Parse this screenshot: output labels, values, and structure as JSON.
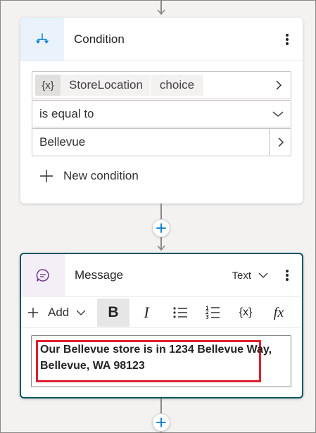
{
  "condition_card": {
    "title": "Condition",
    "variable_icon_text": "{x}",
    "variable_name": "StoreLocation",
    "variable_type": "choice",
    "operator": "is equal to",
    "value": "Bellevue",
    "new_condition_label": "New condition"
  },
  "message_card": {
    "title": "Message",
    "type_selector": "Text",
    "add_label": "Add",
    "bold_label": "B",
    "italic_label": "I",
    "variable_label": "{x}",
    "formula_label": "fx",
    "message_text": "Our Bellevue store is in 1234 Bellevue Way, Bellevue, WA 98123"
  },
  "colors": {
    "accent_blue": "#0078d4",
    "message_border": "#0b5563",
    "message_icon": "#6b2f86",
    "highlight_box": "#e0202e"
  }
}
